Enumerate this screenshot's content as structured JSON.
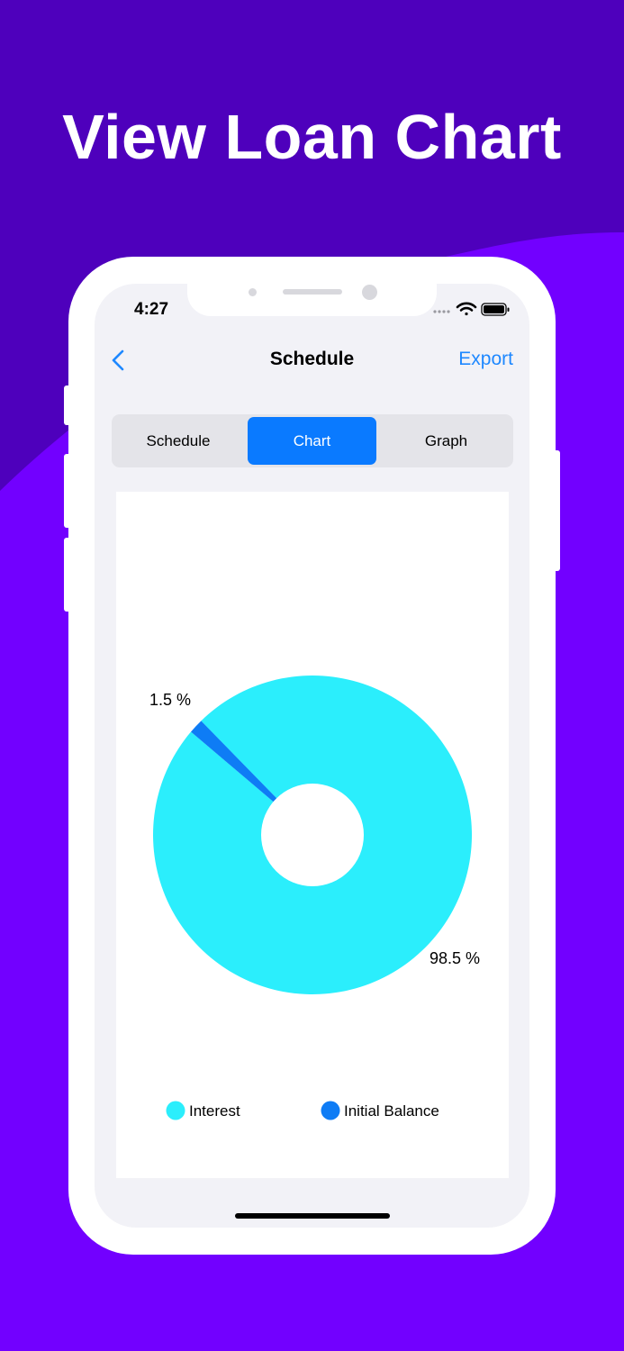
{
  "headline": "View Loan Chart",
  "status_bar": {
    "time": "4:27"
  },
  "nav": {
    "title": "Schedule",
    "export_label": "Export"
  },
  "segments": [
    {
      "label": "Schedule",
      "active": false
    },
    {
      "label": "Chart",
      "active": true
    },
    {
      "label": "Graph",
      "active": false
    }
  ],
  "colors": {
    "background_top": "#4E00BC",
    "background_bottom": "#7200FF",
    "accent": "#0A7AFF",
    "interest": "#2BEEFC",
    "initial_balance": "#0E7CF5"
  },
  "icons": [
    "chevron-left-icon",
    "wifi-icon",
    "battery-icon",
    "signal-icon"
  ],
  "chart_data": {
    "type": "pie",
    "donut": true,
    "series": [
      {
        "name": "Interest",
        "value": 98.5,
        "label": "98.5 %",
        "color": "#2BEEFC"
      },
      {
        "name": "Initial Balance",
        "value": 1.5,
        "label": "1.5 %",
        "color": "#0E7CF5"
      }
    ],
    "legend_placement": "bottom"
  }
}
